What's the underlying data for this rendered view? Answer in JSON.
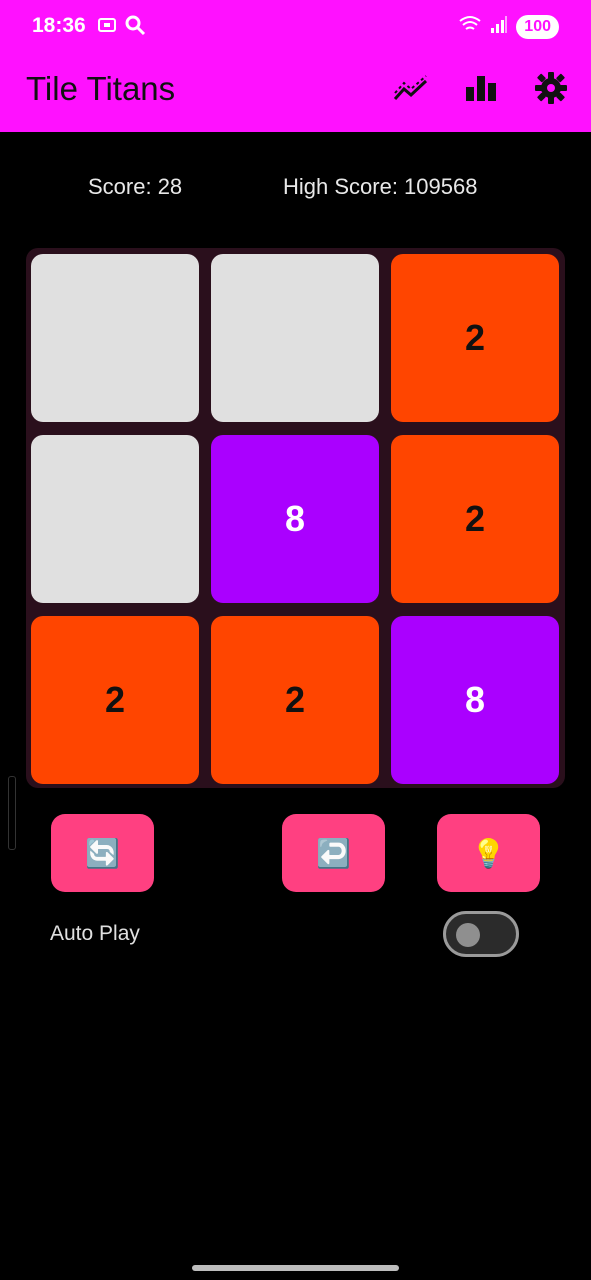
{
  "status_bar": {
    "time": "18:36",
    "battery": "100",
    "icons": [
      "screenshot-icon",
      "search-icon",
      "wifi-icon",
      "signal-icon"
    ]
  },
  "app_bar": {
    "title": "Tile Titans",
    "actions": [
      "stats-trend-icon",
      "leaderboard-icon",
      "settings-icon"
    ]
  },
  "scores": {
    "score_text": "Score: 28",
    "high_score_text": "High Score: 109568"
  },
  "board": {
    "rows": 3,
    "cols": 3,
    "tiles": [
      {
        "value": ""
      },
      {
        "value": ""
      },
      {
        "value": "2"
      },
      {
        "value": ""
      },
      {
        "value": "8"
      },
      {
        "value": "2"
      },
      {
        "value": "2"
      },
      {
        "value": "2"
      },
      {
        "value": "8"
      }
    ]
  },
  "controls": {
    "restart_icon": "🔄",
    "undo_icon": "↩️",
    "hint_icon": "💡",
    "auto_play_label": "Auto Play",
    "auto_play_on": false
  },
  "colors": {
    "app_bar": "#ff11ff",
    "tile_empty": "#e0e0e0",
    "tile_2": "#ff4500",
    "tile_8": "#aa00ff",
    "button": "#ff4081",
    "board_bg": "#2a0f1c"
  }
}
